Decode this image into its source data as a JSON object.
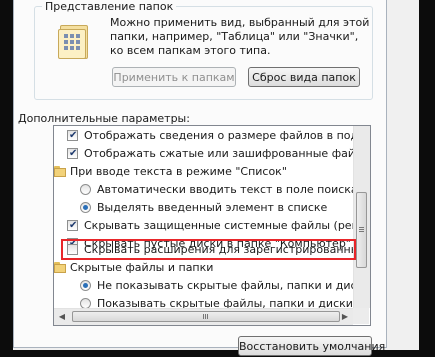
{
  "folder_views": {
    "title": "Представление папок",
    "description": [
      "Можно применить вид, выбранный для этой",
      "папки, например, \"Таблица\" или \"Значки\",",
      "ко всем папкам этого типа."
    ],
    "apply_button": "Применить к папкам",
    "reset_button": "Сброс вида папок"
  },
  "advanced": {
    "label": "Дополнительные параметры:",
    "items": [
      {
        "kind": "checkbox",
        "checked": true,
        "text": "Отображать сведения о размере файлов в подсказка"
      },
      {
        "kind": "checkbox",
        "checked": true,
        "text": "Отображать сжатые или зашифрованные файлы NTF"
      },
      {
        "kind": "folder",
        "text": "При вводе текста в режиме \"Список\""
      },
      {
        "kind": "radio",
        "checked": false,
        "text": "Автоматически вводить текст в поле поиска"
      },
      {
        "kind": "radio",
        "checked": true,
        "text": "Выделять введенный элемент в списке"
      },
      {
        "kind": "checkbox",
        "checked": true,
        "text": "Скрывать защищенные системные файлы (рекоменд"
      },
      {
        "kind": "checkbox",
        "checked": true,
        "text": "Скрывать пустые диски в папке \"Компьютер\""
      },
      {
        "kind": "checkbox",
        "checked": false,
        "text": "Скрывать расширения для зарегистрированных типо",
        "highlighted": true
      },
      {
        "kind": "folder",
        "text": "Скрытые файлы и папки"
      },
      {
        "kind": "radio",
        "checked": true,
        "text": "Не показывать скрытые файлы, папки и диски"
      },
      {
        "kind": "radio",
        "checked": false,
        "text": "Показывать скрытые файлы, папки и диски"
      }
    ]
  },
  "restore_defaults": "Восстановить умолчания",
  "colors": {
    "highlight": "#e8262a",
    "accent": "#2a6fb8"
  }
}
